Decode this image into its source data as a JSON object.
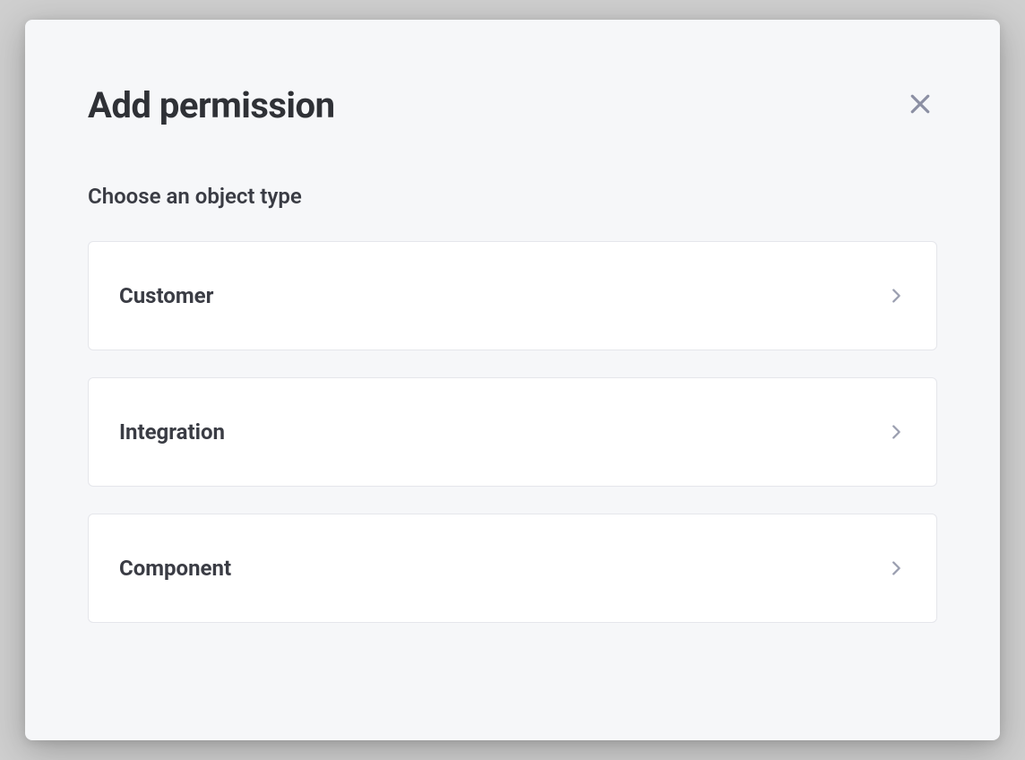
{
  "modal": {
    "title": "Add permission",
    "section_label": "Choose an object type",
    "options": [
      {
        "label": "Customer"
      },
      {
        "label": "Integration"
      },
      {
        "label": "Component"
      }
    ]
  }
}
